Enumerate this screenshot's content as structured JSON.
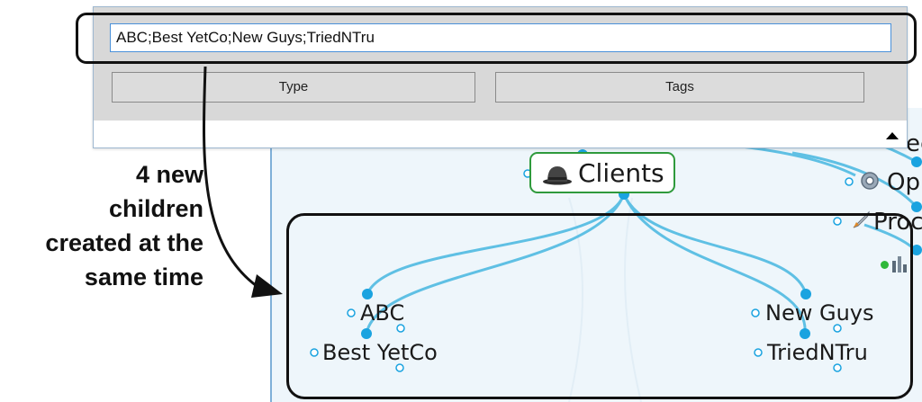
{
  "tag_input": {
    "value": "ABC;Best YetCo;New Guys;TriedNTru"
  },
  "buttons": {
    "type": "Type",
    "tags": "Tags"
  },
  "annotation": {
    "lines": [
      "4 new",
      "children",
      "created at the",
      "same time"
    ]
  },
  "mindmap": {
    "parent": {
      "label": "Clients",
      "icon": "hat-icon"
    },
    "children": [
      {
        "label": "ABC"
      },
      {
        "label": "Best YetCo"
      },
      {
        "label": "New Guys"
      },
      {
        "label": "TriedNTru"
      }
    ],
    "partial_labels": [
      "ee",
      "Op",
      "Proc"
    ],
    "side_icons": [
      "gear-icon",
      "rocket-icon",
      "chart-icon"
    ]
  },
  "colors": {
    "link": "#5fc0e4",
    "dot": "#1aa3e0",
    "parent_border": "#2f9a3c",
    "annotation": "#111111",
    "input_border": "#4a90d9"
  }
}
